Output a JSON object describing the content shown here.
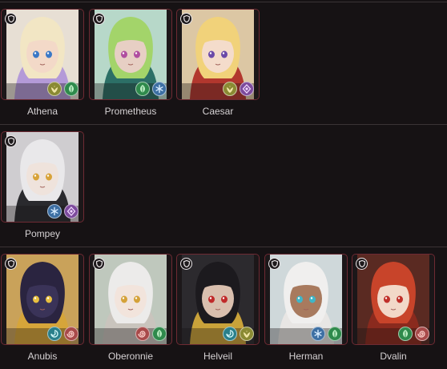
{
  "roster": {
    "rows": [
      {
        "heroes": [
          {
            "name": "Athena",
            "portrait": {
              "hair": "#f2e6c4",
              "skin": "#f3d9c8",
              "accent": "#b49ad8",
              "bg": "#e7dfd4",
              "eye": "#3b78c6"
            },
            "badges": [
              {
                "icon": "wings-icon",
                "color": "#8a8a33"
              },
              {
                "icon": "leaf-icon",
                "color": "#2f8a4c"
              }
            ]
          },
          {
            "name": "Prometheus",
            "portrait": {
              "hair": "#a3d46a",
              "skin": "#e7cfc4",
              "accent": "#2c6f66",
              "bg": "#b7d8c9",
              "eye": "#b04fa0"
            },
            "badges": [
              {
                "icon": "leaf-icon",
                "color": "#2f8a4c"
              },
              {
                "icon": "snowflake-icon",
                "color": "#3d6fa3"
              }
            ]
          },
          {
            "name": "Caesar",
            "portrait": {
              "hair": "#f1d27a",
              "skin": "#f4dccb",
              "accent": "#b2372e",
              "bg": "#dcc7a4",
              "eye": "#6b4aa8"
            },
            "badges": [
              {
                "icon": "wings-icon",
                "color": "#8a8a33"
              },
              {
                "icon": "crystal-icon",
                "color": "#7c4a9c"
              }
            ]
          }
        ]
      },
      {
        "heroes": [
          {
            "name": "Pompey",
            "portrait": {
              "hair": "#e9e8ea",
              "skin": "#efe3dc",
              "accent": "#2a2a2e",
              "bg": "#cfcdd0",
              "eye": "#d8a33a"
            },
            "badges": [
              {
                "icon": "snowflake-icon",
                "color": "#3d6fa3"
              },
              {
                "icon": "crystal-icon",
                "color": "#7c4a9c"
              }
            ]
          }
        ]
      },
      {
        "heroes": [
          {
            "name": "Anubis",
            "portrait": {
              "hair": "#2a2440",
              "skin": "#3a3358",
              "accent": "#d6a53a",
              "bg": "#c9a25a",
              "eye": "#e8c040"
            },
            "badges": [
              {
                "icon": "wave-icon",
                "color": "#2a7f8a"
              },
              {
                "icon": "spiral-icon",
                "color": "#a84a4a"
              }
            ]
          },
          {
            "name": "Oberonnie",
            "portrait": {
              "hair": "#ecebea",
              "skin": "#f2e4dc",
              "accent": "#c9c4bd",
              "bg": "#bfc8bd",
              "eye": "#d4a23a"
            },
            "badges": [
              {
                "icon": "spiral-icon",
                "color": "#a84a4a"
              },
              {
                "icon": "leaf-icon",
                "color": "#2f8a4c"
              }
            ]
          },
          {
            "name": "Helveil",
            "portrait": {
              "hair": "#1c1a1e",
              "skin": "#d9bfae",
              "accent": "#c9a23a",
              "bg": "#2c2a2e",
              "eye": "#c02a2a"
            },
            "badges": [
              {
                "icon": "wave-icon",
                "color": "#2a7f8a"
              },
              {
                "icon": "wings-icon",
                "color": "#8a8a33"
              }
            ]
          },
          {
            "name": "Herman",
            "portrait": {
              "hair": "#f0efee",
              "skin": "#a87a5e",
              "accent": "#e8e6e4",
              "bg": "#cfd8da",
              "eye": "#3fb6c8"
            },
            "badges": [
              {
                "icon": "snowflake-icon",
                "color": "#3d6fa3"
              },
              {
                "icon": "leaf-icon",
                "color": "#2f8a4c"
              }
            ]
          },
          {
            "name": "Dvalin",
            "portrait": {
              "hair": "#c8442a",
              "skin": "#f2d8c8",
              "accent": "#8a2a1e",
              "bg": "#5a2a22",
              "eye": "#c0302a"
            },
            "badges": [
              {
                "icon": "leaf-icon",
                "color": "#2f8a4c"
              },
              {
                "icon": "spiral-icon",
                "color": "#a84a4a"
              }
            ]
          }
        ]
      }
    ]
  },
  "colors": {
    "background": "#161214",
    "card_border": "#6e2a33",
    "divider": "#3a3335",
    "label": "#d6d2d4"
  }
}
